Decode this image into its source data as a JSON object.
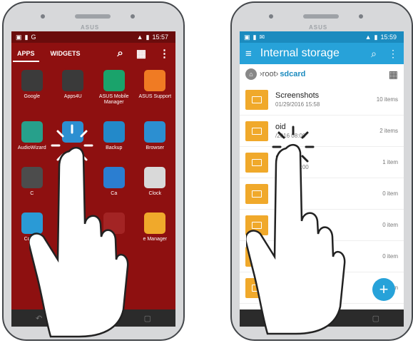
{
  "left_phone": {
    "brand": "ASUS",
    "status": {
      "time": "15:57"
    },
    "tabs": [
      {
        "label": "APPS"
      },
      {
        "label": "WIDGETS"
      }
    ],
    "apps": [
      {
        "label": "Google",
        "icon": "google-folder-icon",
        "color": "#3b3b3b"
      },
      {
        "label": "Apps4U",
        "icon": "apps4u-icon",
        "color": "#3a3a3a"
      },
      {
        "label": "ASUS Mobile Manager",
        "icon": "mobile-manager-icon",
        "color": "#1aa36b"
      },
      {
        "label": "ASUS Support",
        "icon": "support-icon",
        "color": "#f07b23"
      },
      {
        "label": "AudioWizard",
        "icon": "audiowizard-icon",
        "color": "#27a08b"
      },
      {
        "label": "",
        "icon": "file-manager-app-icon",
        "color": "#2c8fd1"
      },
      {
        "label": "Backup",
        "icon": "backup-icon",
        "color": "#2389c9"
      },
      {
        "label": "Browser",
        "icon": "browser-icon",
        "color": "#2c8fd1"
      },
      {
        "label": "C",
        "icon": "calculator-icon",
        "color": "#4c4c4c"
      },
      {
        "label": "",
        "icon": "hidden-app-icon",
        "color": "#a32424"
      },
      {
        "label": "Ca",
        "icon": "camera-icon",
        "color": "#2b7ed1"
      },
      {
        "label": "Clock",
        "icon": "clock-icon",
        "color": "#d9d9d9"
      },
      {
        "label": "Contac",
        "icon": "contacts-icon",
        "color": "#2a9ad6"
      },
      {
        "label": "",
        "icon": "hidden-app-icon",
        "color": "#a32424"
      },
      {
        "label": "",
        "icon": "hidden-app-icon",
        "color": "#a32424"
      },
      {
        "label": "e Manager",
        "icon": "file-manager-icon",
        "color": "#f0a92b"
      }
    ]
  },
  "right_phone": {
    "brand": "ASUS",
    "status": {
      "time": "15:59"
    },
    "title": "Internal storage",
    "breadcrumb": {
      "root": "root",
      "current": "sdcard"
    },
    "files": [
      {
        "name": "Screenshots",
        "date": "01/29/2016 15:58",
        "count": "10 items"
      },
      {
        "name": "oid",
        "date": "/2016 08:00",
        "count": "2 items"
      },
      {
        "name": "S",
        "date": "1/2016 08:00",
        "count": "1 item"
      },
      {
        "name": "",
        "date": "",
        "count": "0 item"
      },
      {
        "name": "",
        "date": "",
        "count": "0 item"
      },
      {
        "name": "",
        "date": "",
        "count": "0 item"
      },
      {
        "name": "",
        "date": "",
        "count": "item"
      }
    ]
  }
}
